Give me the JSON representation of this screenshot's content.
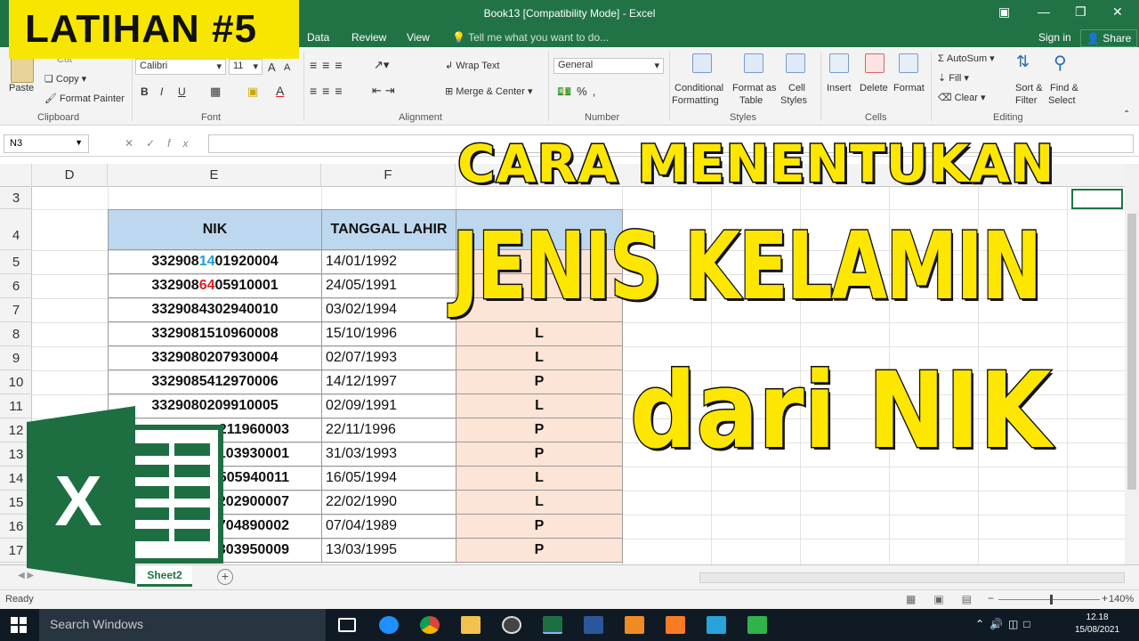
{
  "window": {
    "title": "Book13  [Compatibility Mode] - Excel",
    "tabs": [
      "Data",
      "Review",
      "View"
    ],
    "tell_me": "Tell me what you want to do...",
    "sign_in": "Sign in",
    "share": "Share"
  },
  "ribbon": {
    "clipboard": {
      "label": "Clipboard",
      "paste": "Paste",
      "cut": "Cut",
      "copy": "Copy",
      "format_painter": "Format Painter"
    },
    "font": {
      "label": "Font",
      "name": "Calibri",
      "size": "11",
      "bold": "B",
      "italic": "I",
      "underline": "U"
    },
    "alignment": {
      "label": "Alignment",
      "wrap_text": "Wrap Text",
      "merge_center": "Merge & Center"
    },
    "number": {
      "label": "Number",
      "format": "General"
    },
    "styles": {
      "label": "Styles",
      "conditional_1": "Conditional",
      "conditional_2": "Formatting",
      "format_table_1": "Format as",
      "format_table_2": "Table",
      "cell_styles_1": "Cell",
      "cell_styles_2": "Styles"
    },
    "cells": {
      "label": "Cells",
      "insert": "Insert",
      "delete": "Delete",
      "format": "Format"
    },
    "editing": {
      "label": "Editing",
      "autosum": "AutoSum",
      "fill": "Fill",
      "clear": "Clear",
      "sort_1": "Sort &",
      "sort_2": "Filter",
      "find_1": "Find &",
      "find_2": "Select"
    }
  },
  "formula_bar": {
    "name_box": "N3",
    "fx": "fx",
    "value": ""
  },
  "columns": [
    "D",
    "E",
    "F"
  ],
  "rows": [
    "3",
    "4",
    "5",
    "6",
    "7",
    "8",
    "9",
    "10",
    "11",
    "12",
    "13",
    "14",
    "15",
    "16",
    "17"
  ],
  "table": {
    "headers": {
      "nik": "NIK",
      "tgl": "TANGGAL LAHIR"
    },
    "rows": [
      {
        "nik_a": "332908",
        "nik_b": "14",
        "nik_c": "01920004",
        "tgl": "14/01/1992",
        "jk": ""
      },
      {
        "nik_a": "332908",
        "nik_b": "64",
        "nik_c": "05910001",
        "tgl": "24/05/1991",
        "jk": ""
      },
      {
        "nik_a": "3329084302940010",
        "nik_b": "",
        "nik_c": "",
        "tgl": "03/02/1994",
        "jk": ""
      },
      {
        "nik_a": "3329081510960008",
        "nik_b": "",
        "nik_c": "",
        "tgl": "15/10/1996",
        "jk": "L"
      },
      {
        "nik_a": "3329080207930004",
        "nik_b": "",
        "nik_c": "",
        "tgl": "02/07/1993",
        "jk": "L"
      },
      {
        "nik_a": "3329085412970006",
        "nik_b": "",
        "nik_c": "",
        "tgl": "14/12/1997",
        "jk": "P"
      },
      {
        "nik_a": "3329080209910005",
        "nik_b": "",
        "nik_c": "",
        "tgl": "02/09/1991",
        "jk": "L"
      },
      {
        "nik_a": "211960003",
        "nik_b": "",
        "nik_c": "",
        "tgl": "22/11/1996",
        "jk": "P"
      },
      {
        "nik_a": "103930001",
        "nik_b": "",
        "nik_c": "",
        "tgl": "31/03/1993",
        "jk": "P"
      },
      {
        "nik_a": "505940011",
        "nik_b": "",
        "nik_c": "",
        "tgl": "16/05/1994",
        "jk": "L"
      },
      {
        "nik_a": "202900007",
        "nik_b": "",
        "nik_c": "",
        "tgl": "22/02/1990",
        "jk": "L"
      },
      {
        "nik_a": "704890002",
        "nik_b": "",
        "nik_c": "",
        "tgl": "07/04/1989",
        "jk": "P"
      },
      {
        "nik_a": "303950009",
        "nik_b": "",
        "nik_c": "",
        "tgl": "13/03/1995",
        "jk": "P"
      }
    ]
  },
  "sheet_tab": "Sheet2",
  "status": {
    "ready": "Ready",
    "zoom": "140%"
  },
  "taskbar": {
    "search": "Search Windows",
    "time": "12.18",
    "date": "15/08/2021"
  },
  "overlay": {
    "latihan": "LATIHAN #5",
    "line1": "CARA MENENTUKAN",
    "line2": "JENIS KELAMIN",
    "line3": "dari NIK"
  },
  "colors": {
    "excel_green": "#217346",
    "header_blue": "#bdd7ee",
    "jk_fill": "#fce4d6",
    "overlay_yellow": "#fde700"
  }
}
